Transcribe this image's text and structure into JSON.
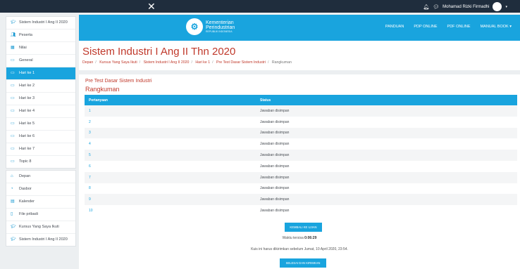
{
  "topbar": {
    "close_glyph": "✕",
    "user_name": "Mohamad Rizki Firmadhi",
    "icons": [
      "bell-icon",
      "chat-icon",
      "caret-icon"
    ]
  },
  "sidebar": {
    "course_group": [
      {
        "label": "Sistem Industri I Ang II 2020",
        "icon": "graduation-cap-icon"
      },
      {
        "label": "Peserta",
        "icon": "users-icon"
      },
      {
        "label": "Nilai",
        "icon": "table-icon"
      },
      {
        "label": "General",
        "icon": "folder-icon"
      },
      {
        "label": "Hari ke 1",
        "icon": "folder-icon",
        "active": true
      },
      {
        "label": "Hari ke 2",
        "icon": "folder-icon"
      },
      {
        "label": "Hari ke 3",
        "icon": "folder-icon"
      },
      {
        "label": "Hari ke 4",
        "icon": "folder-icon"
      },
      {
        "label": "Hari ke 5",
        "icon": "folder-icon"
      },
      {
        "label": "Hari ke 6",
        "icon": "folder-icon"
      },
      {
        "label": "Hari ke 7",
        "icon": "folder-icon"
      },
      {
        "label": "Topic 8",
        "icon": "folder-icon"
      }
    ],
    "site_group": [
      {
        "label": "Depan",
        "icon": "home-icon"
      },
      {
        "label": "Dasbor",
        "icon": "dashboard-icon"
      },
      {
        "label": "Kalender",
        "icon": "calendar-icon"
      },
      {
        "label": "File pribadi",
        "icon": "file-icon"
      },
      {
        "label": "Kursus Yang Saya Ikuti",
        "icon": "graduation-cap-icon"
      },
      {
        "label": "Sistem Industri I Ang II 2020",
        "icon": "graduation-cap-icon"
      }
    ]
  },
  "header": {
    "logo_line1": "Kementerian",
    "logo_line2": "Perindustrian",
    "logo_line3": "REPUBLIK INDONESIA",
    "nav": [
      "PANDUAN",
      "PDP ONLINE",
      "PDF ONLINE",
      "MANUAL BOOK ▾"
    ]
  },
  "main": {
    "title": "Sistem Industri I Ang II Thn 2020",
    "breadcrumb": [
      "Depan",
      "Kursus Yang Saya Ikuti",
      "Sistem Industri I Ang II 2020",
      "Hari ke 1",
      "Pre Test Dasar Sistem Industri",
      "Rangkuman"
    ],
    "quiz_name": "Pre Test Dasar Sistem Industri",
    "summary_title": "Rangkuman",
    "table": {
      "headers": [
        "Pertanyaan",
        "Status"
      ],
      "rows": [
        [
          "1",
          "Jawaban disimpan"
        ],
        [
          "2",
          "Jawaban disimpan"
        ],
        [
          "3",
          "Jawaban disimpan"
        ],
        [
          "4",
          "Jawaban disimpan"
        ],
        [
          "5",
          "Jawaban disimpan"
        ],
        [
          "6",
          "Jawaban disimpan"
        ],
        [
          "7",
          "Jawaban disimpan"
        ],
        [
          "8",
          "Jawaban disimpan"
        ],
        [
          "9",
          "Jawaban disimpan"
        ],
        [
          "10",
          "Jawaban disimpan"
        ]
      ]
    },
    "return_button": "KEMBALI KE UJIAN",
    "time_left_label": "Waktu tersisa",
    "time_left_value": "0:06:29",
    "deadline_text": "Kuis ini harus dikirimkan sebelum Jumat, 10 April 2020, 23:54.",
    "submit_button": "SELESAI DAN KIRIMKAN"
  },
  "colors": {
    "accent": "#19a4de",
    "title_red": "#c0392b",
    "topbar": "#1f2d3d"
  }
}
